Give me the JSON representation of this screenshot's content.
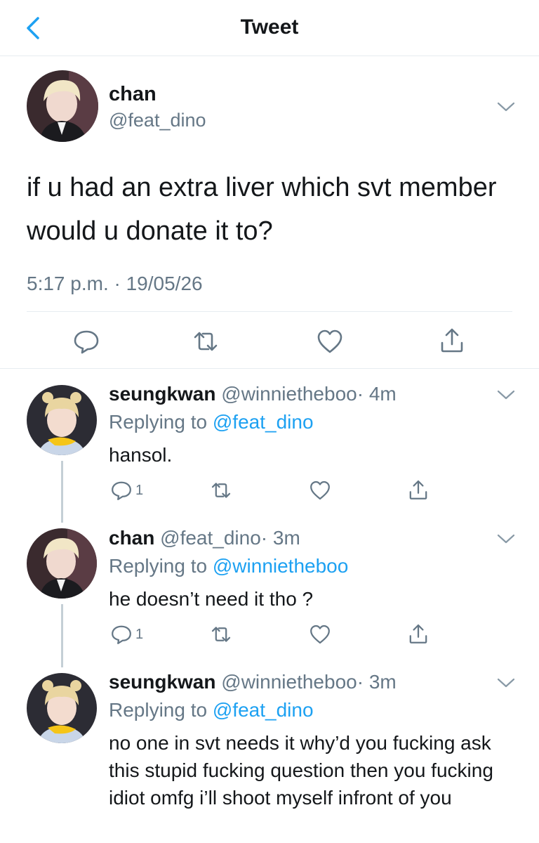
{
  "header": {
    "title": "Tweet",
    "back_icon": "chevron-left-icon"
  },
  "colors": {
    "accent": "#1da1f2",
    "muted": "#657786",
    "text": "#14171a",
    "divider": "#e6ecf0"
  },
  "main_tweet": {
    "name": "chan",
    "handle": "@feat_dino",
    "text": "if u had an extra liver which svt member would u donate it to?",
    "timestamp": "5:17 p.m. · 19/05/26",
    "actions": [
      "reply-icon",
      "retweet-icon",
      "like-icon",
      "share-icon"
    ]
  },
  "replies": [
    {
      "name": "seungkwan",
      "handle": "@winnietheboo",
      "time": "· 4m",
      "replying_prefix": "Replying to ",
      "replying_to": "@feat_dino",
      "text": "hansol.",
      "reply_count": "1"
    },
    {
      "name": "chan",
      "handle": "@feat_dino",
      "time": "· 3m",
      "replying_prefix": "Replying to ",
      "replying_to": "@winnietheboo",
      "text": "he doesn’t need it tho ?",
      "reply_count": "1"
    },
    {
      "name": "seungkwan",
      "handle": "@winnietheboo",
      "time": "· 3m",
      "replying_prefix": "Replying to ",
      "replying_to": "@feat_dino",
      "text": "no one in svt needs it why’d you fucking ask this stupid fucking question then you fucking idiot omfg i’ll shoot myself infront of you"
    }
  ]
}
